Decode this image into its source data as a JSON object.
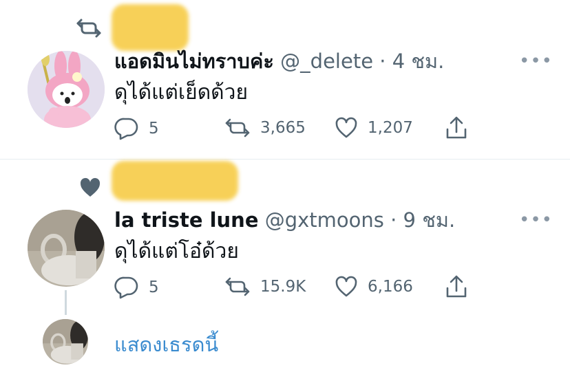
{
  "tweets": [
    {
      "context": {
        "icon": "retweet-icon"
      },
      "author": {
        "name": "แอดมินไม่ทราบค่ะ",
        "handle": "@_delete",
        "sep": "·",
        "time": "4 ชม."
      },
      "text": "ดุได้แต่เย็ดด้วย",
      "stats": {
        "replies": "5",
        "retweets": "3,665",
        "likes": "1,207"
      }
    },
    {
      "context": {
        "icon": "heart-filled-icon"
      },
      "author": {
        "name": "la triste lune",
        "handle": "@gxtmoons",
        "sep": "·",
        "time": "9 ชม."
      },
      "text": "ดุได้แต่โอ๋ด้วย",
      "stats": {
        "replies": "5",
        "retweets": "15.9K",
        "likes": "6,166"
      }
    }
  ],
  "show_thread": "แสดงเธรดนี้",
  "more_glyph": "•••",
  "colors": {
    "secondary": "#536471",
    "link": "#3a8bcf",
    "divider": "#e6ecf0"
  }
}
